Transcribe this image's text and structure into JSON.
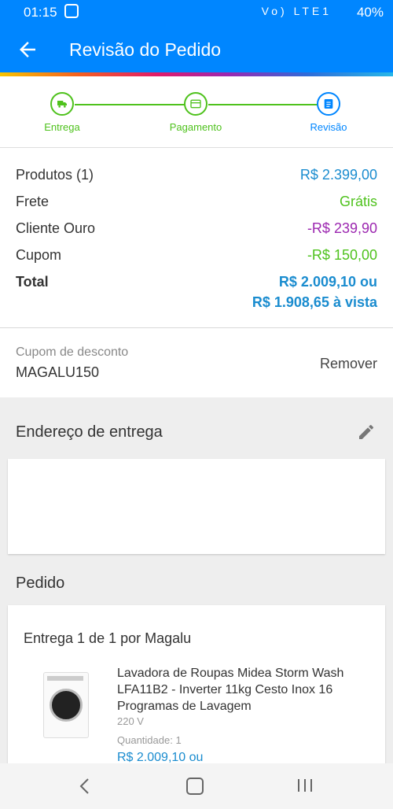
{
  "status_bar": {
    "time": "01:15",
    "battery": "40%",
    "icons": "Vo) LTE1"
  },
  "header": {
    "title": "Revisão do Pedido"
  },
  "stepper": [
    {
      "label": "Entrega"
    },
    {
      "label": "Pagamento"
    },
    {
      "label": "Revisão"
    }
  ],
  "summary": {
    "products_label": "Produtos (1)",
    "products_value": "R$ 2.399,00",
    "shipping_label": "Frete",
    "shipping_value": "Grátis",
    "gold_label": "Cliente Ouro",
    "gold_value": "-R$ 239,90",
    "coupon_label": "Cupom",
    "coupon_value": "-R$ 150,00",
    "total_label": "Total",
    "total_value": "R$ 2.009,10 ou",
    "total_cash": "R$ 1.908,65 à vista"
  },
  "coupon": {
    "caption": "Cupom de desconto",
    "code": "MAGALU150",
    "remove": "Remover"
  },
  "address": {
    "title": "Endereço de entrega"
  },
  "order": {
    "title": "Pedido",
    "delivery": "Entrega 1 de 1 por Magalu",
    "product_name": "Lavadora de Roupas Midea Storm Wash LFA11B2 - Inverter 11kg Cesto Inox 16 Programas de Lavagem",
    "voltage": "220 V",
    "quantity": "Quantidade:  1",
    "price": "R$ 2.009,10 ou"
  },
  "colors": {
    "primary": "#0086ff",
    "green": "#4fc21d",
    "purple": "#9c27b0"
  }
}
